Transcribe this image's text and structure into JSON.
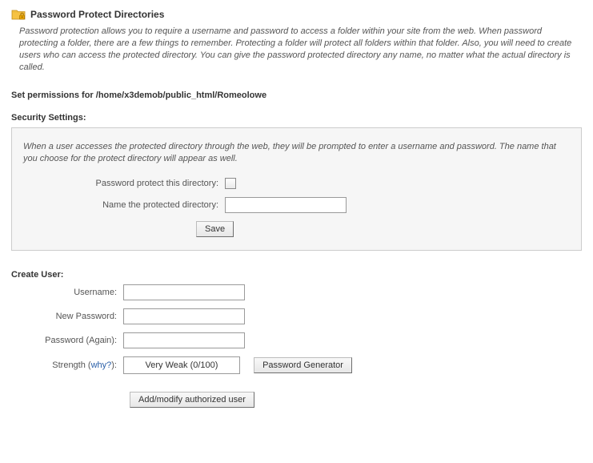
{
  "header": {
    "title": "Password Protect Directories",
    "intro": "Password protection allows you to require a username and password to access a folder within your site from the web. When password protecting a folder, there are a few things to remember. Protecting a folder will protect all folders within that folder. Also, you will need to create users who can access the protected directory. You can give the password protected directory any name, no matter what the actual directory is called."
  },
  "permissions": {
    "label_prefix": "Set permissions for ",
    "path": "/home/x3demob/public_html/Romeolowe"
  },
  "security": {
    "heading": "Security Settings:",
    "intro": "When a user accesses the protected directory through the web, they will be prompted to enter a username and password. The name that you choose for the protect directory will appear as well.",
    "checkbox_label": "Password protect this directory:",
    "name_label": "Name the protected directory:",
    "name_value": "",
    "save_label": "Save"
  },
  "create_user": {
    "heading": "Create User:",
    "username_label": "Username:",
    "username_value": "",
    "newpw_label": "New Password:",
    "newpw_value": "",
    "again_label": "Password (Again):",
    "again_value": "",
    "strength_label_prefix": "Strength (",
    "strength_why": "why?",
    "strength_label_suffix": "):",
    "strength_value": "Very Weak (0/100)",
    "pwgen_label": "Password Generator",
    "submit_label": "Add/modify authorized user"
  }
}
